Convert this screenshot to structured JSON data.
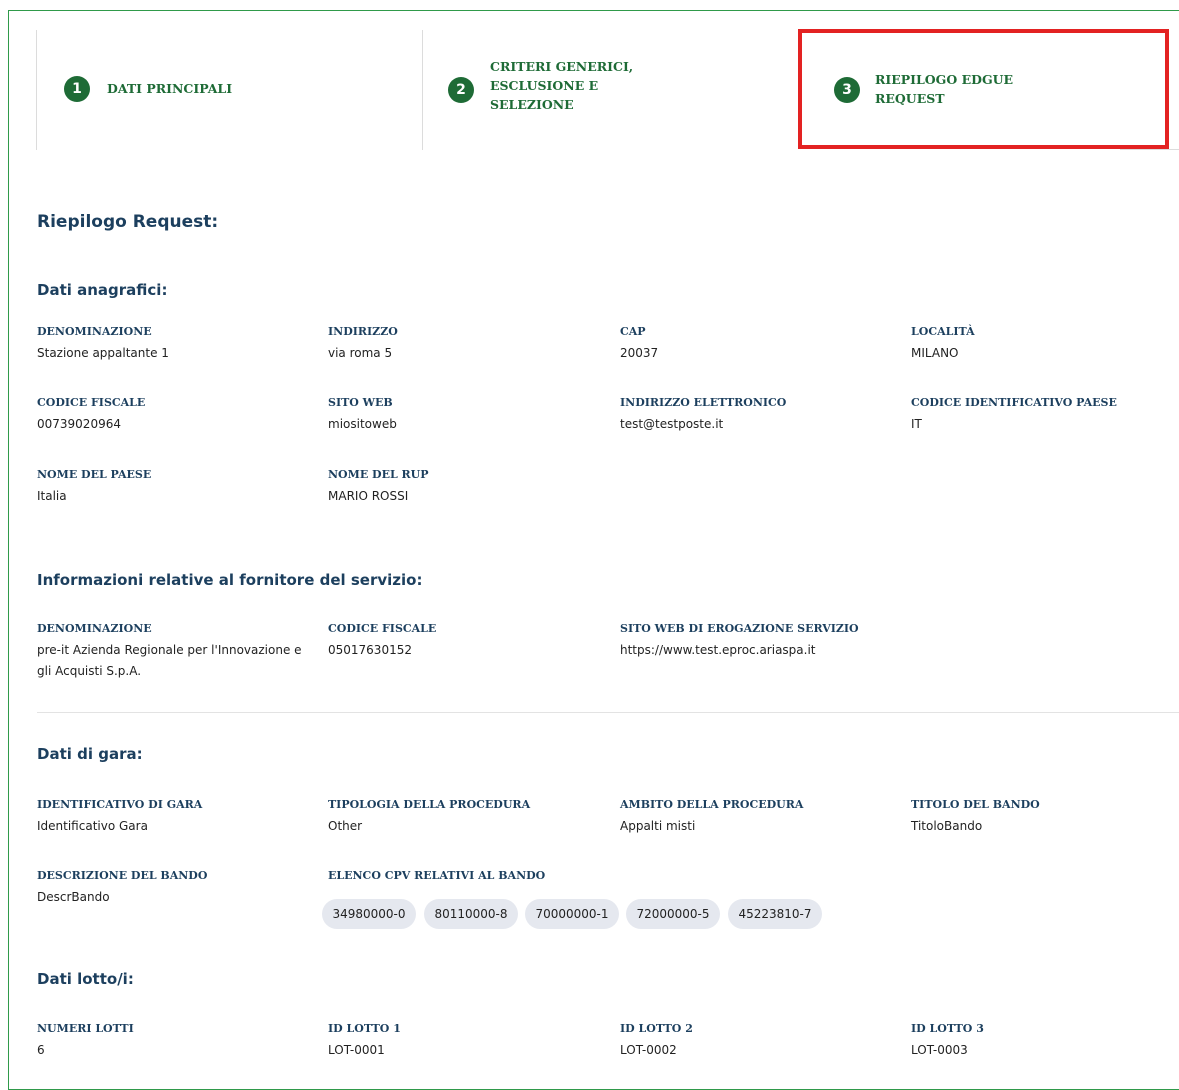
{
  "steps": [
    {
      "number": "1",
      "label_lines": [
        "DATI PRINCIPALI"
      ]
    },
    {
      "number": "2",
      "label_lines": [
        "CRITERI GENERICI,",
        "ESCLUSIONE E",
        "SELEZIONE"
      ]
    },
    {
      "number": "3",
      "label_lines": [
        "RIEPILOGO EDGUE",
        "REQUEST"
      ]
    }
  ],
  "page_title": "Riepilogo Request:",
  "dati_anagrafici": {
    "title": "Dati anagrafici:",
    "fields": [
      {
        "label": "DENOMINAZIONE",
        "value": "Stazione appaltante 1"
      },
      {
        "label": "INDIRIZZO",
        "value": "via roma 5"
      },
      {
        "label": "CAP",
        "value": "20037"
      },
      {
        "label": "LOCALITÀ",
        "value": "MILANO"
      },
      {
        "label": "CODICE FISCALE",
        "value": "00739020964"
      },
      {
        "label": "SITO WEB",
        "value": "miositoweb"
      },
      {
        "label": "INDIRIZZO ELETTRONICO",
        "value": "test@testposte.it"
      },
      {
        "label": "CODICE IDENTIFICATIVO PAESE",
        "value": "IT"
      },
      {
        "label": "NOME DEL PAESE",
        "value": "Italia"
      },
      {
        "label": "NOME DEL RUP",
        "value": "MARIO ROSSI"
      }
    ]
  },
  "fornitore": {
    "title": "Informazioni relative al fornitore del servizio:",
    "fields": [
      {
        "label": "DENOMINAZIONE",
        "value_lines": [
          "pre-it Azienda Regionale per l'Innovazione e",
          "gli Acquisti S.p.A."
        ]
      },
      {
        "label": "CODICE FISCALE",
        "value": "05017630152"
      },
      {
        "label": "SITO WEB DI EROGAZIONE SERVIZIO",
        "value": "https://www.test.eproc.ariaspa.it"
      }
    ]
  },
  "dati_gara": {
    "title": "Dati di gara:",
    "fields": [
      {
        "label": "IDENTIFICATIVO DI GARA",
        "value": "Identificativo Gara"
      },
      {
        "label": "TIPOLOGIA DELLA PROCEDURA",
        "value": "Other"
      },
      {
        "label": "AMBITO DELLA PROCEDURA",
        "value": "Appalti misti"
      },
      {
        "label": "TITOLO DEL BANDO",
        "value": "TitoloBando"
      },
      {
        "label": "DESCRIZIONE DEL BANDO",
        "value": "DescrBando"
      },
      {
        "label": "ELENCO CPV RELATIVI AL BANDO"
      }
    ],
    "cpv": [
      "34980000-0",
      "80110000-8",
      "70000000-1",
      "72000000-5",
      "45223810-7"
    ]
  },
  "dati_lotti": {
    "title": "Dati lotto/i:",
    "fields": [
      {
        "label": "NUMERI LOTTI",
        "value": "6"
      },
      {
        "label": "ID LOTTO 1",
        "value": "LOT-0001"
      },
      {
        "label": "ID LOTTO 2",
        "value": "LOT-0002"
      },
      {
        "label": "ID LOTTO 3",
        "value": "LOT-0003"
      }
    ]
  },
  "colors": {
    "step_green": "#1e6b36",
    "heading_navy": "#1c3f5e",
    "highlight_red": "#e32222",
    "frame_green": "#2f9a4a"
  }
}
